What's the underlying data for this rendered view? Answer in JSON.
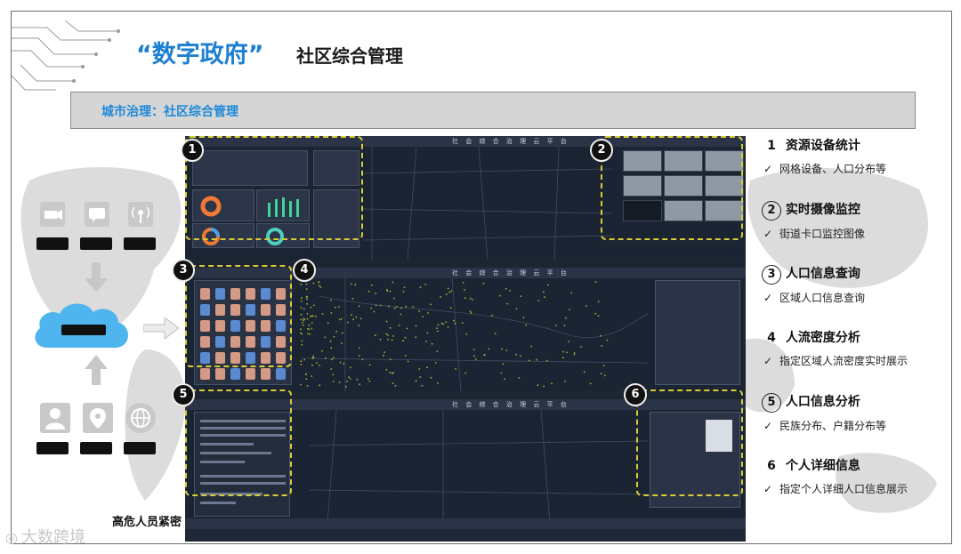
{
  "header": {
    "title_quoted": "“数字政府”",
    "title_main": "社区综合管理"
  },
  "banner": {
    "label": "城市治理：社区综合管理"
  },
  "screens": {
    "platform_title": "社 会 综 合 治 理 云 平 台",
    "markers": [
      "1",
      "2",
      "3",
      "4",
      "5",
      "6"
    ]
  },
  "features": [
    {
      "num": "1",
      "title": "资源设备统计",
      "desc": "网格设备、人口分布等",
      "circled": false
    },
    {
      "num": "2",
      "title": "实时摄像监控",
      "desc": "街道卡口监控图像",
      "circled": true
    },
    {
      "num": "3",
      "title": "人口信息查询",
      "desc": "区域人口信息查询",
      "circled": true
    },
    {
      "num": "4",
      "title": "人流密度分析",
      "desc": "指定区域人流密度实时展示",
      "circled": false
    },
    {
      "num": "5",
      "title": "人口信息分析",
      "desc": "民族分布、户籍分布等",
      "circled": true
    },
    {
      "num": "6",
      "title": "个人详细信息",
      "desc": "指定个人详细人口信息展示",
      "circled": false
    }
  ],
  "check_mark": "✓",
  "caption": "高危人员紧密",
  "watermark": "大数跨境",
  "icons": [
    "camera-icon",
    "chat-icon",
    "broadcast-icon",
    "cloud-icon",
    "person-icon",
    "location-icon",
    "globe-icon"
  ],
  "colors": {
    "accent_blue": "#1d7fd1",
    "marker_yellow": "#d8cc37",
    "screen_bg": "#1f2838"
  }
}
